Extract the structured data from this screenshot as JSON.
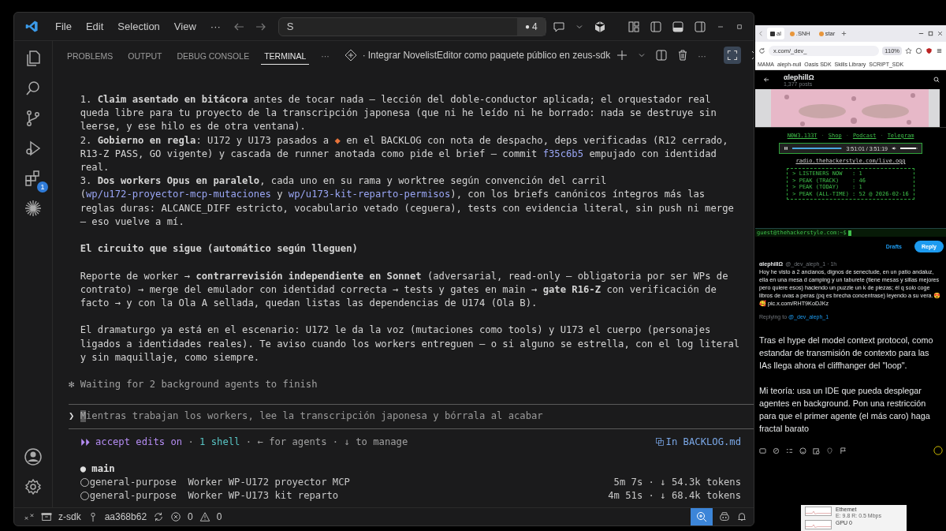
{
  "titlebar": {
    "menu": [
      "File",
      "Edit",
      "Selection",
      "View"
    ],
    "more": "···",
    "search": {
      "value": "S"
    },
    "session_dot": "●",
    "session_count": "4"
  },
  "activity_bar": {
    "extensions_badge": "1"
  },
  "panel": {
    "tabs": [
      {
        "label": "PROBLEMS",
        "selected": false
      },
      {
        "label": "OUTPUT",
        "selected": false
      },
      {
        "label": "DEBUG CONSOLE",
        "selected": false
      },
      {
        "label": "TERMINAL",
        "selected": true
      }
    ],
    "more": "···",
    "title_separator": "·",
    "terminal_title": "Integrar NovelistEditor como paquete público en zeus-sdk",
    "terminal_more": "···",
    "maximized": true
  },
  "terminal": {
    "blocks": [
      {
        "kind": "item",
        "segments": [
          {
            "kind": "plain",
            "text": "1. "
          },
          {
            "kind": "bold",
            "text": "Claim asentado en bitácora"
          },
          {
            "kind": "plain",
            "text": " antes de tocar nada — lección del doble-conductor aplicada; el orquestador real queda libre para tu proyecto de la transcripción japonesa (que ni he leído ni he borrado: nada se destruye sin leerse, y ese hilo es de otra ventana)."
          }
        ]
      },
      {
        "kind": "item",
        "segments": [
          {
            "kind": "plain",
            "text": "2. "
          },
          {
            "kind": "bold",
            "text": "Gobierno en regla"
          },
          {
            "kind": "plain",
            "text": ": U172 y U173 pasados a "
          },
          {
            "kind": "diamond",
            "text": "◆"
          },
          {
            "kind": "plain",
            "text": " en el BACKLOG con nota de despacho, deps verificadas (R12 cerrado, R13-Z PASS, GO vigente) y cascada de runner anotada como pide el brief — commit "
          },
          {
            "kind": "link",
            "text": "f35c6b5"
          },
          {
            "kind": "plain",
            "text": " empujado con identidad real."
          }
        ]
      },
      {
        "kind": "item",
        "segments": [
          {
            "kind": "plain",
            "text": "3. "
          },
          {
            "kind": "bold",
            "text": "Dos workers Opus en paralelo"
          },
          {
            "kind": "plain",
            "text": ", cada uno en su rama y worktree según convención del carril ("
          },
          {
            "kind": "link",
            "text": "wp/u172-proyector-mcp-mutaciones"
          },
          {
            "kind": "plain",
            "text": " y "
          },
          {
            "kind": "link",
            "text": "wp/u173-kit-reparto-permisos"
          },
          {
            "kind": "plain",
            "text": "), con los briefs canónicos íntegros más las reglas duras: ALCANCE_DIFF estricto, vocabulario vetado (ceguera), tests con evidencia literal, sin push ni merge — eso vuelve a mí."
          }
        ]
      },
      {
        "kind": "heading",
        "segments": [
          {
            "kind": "plain",
            "text": "El circuito que sigue (automático según lleguen)"
          }
        ]
      },
      {
        "kind": "paragraph",
        "segments": [
          {
            "kind": "plain",
            "text": "Reporte de worker → "
          },
          {
            "kind": "bold",
            "text": "contrarrevisión independiente en Sonnet"
          },
          {
            "kind": "plain",
            "text": " (adversarial, read-only — obligatoria por ser WPs de contrato) → merge del emulador con identidad correcta → tests y gates en main → "
          },
          {
            "kind": "bold",
            "text": "gate R16-Z"
          },
          {
            "kind": "plain",
            "text": " con verificación de facto → y con la Ola A sellada, quedan listas las dependencias de U174 (Ola B)."
          }
        ]
      },
      {
        "kind": "paragraph",
        "segments": [
          {
            "kind": "plain",
            "text": "El dramaturgo ya está en el escenario: U172 le da la voz (mutaciones como tools) y U173 el cuerpo (personajes ligados a identidades reales). Te aviso cuando los workers entreguen — o si alguno se estrella, con el log literal y sin maquillaje, como siempre."
          }
        ]
      }
    ],
    "status": {
      "spinner": "✻",
      "text": "Waiting for 2 background agents to finish"
    },
    "prompt": {
      "symbol": "❯",
      "value": "Mientras trabajan los workers, lee la transcripción japonesa y bórrala al acabar"
    },
    "mode_line": [
      {
        "kind": "mode",
        "text": "⏵⏵ accept edits on"
      },
      {
        "kind": "dim",
        "text": " · "
      },
      {
        "kind": "shell",
        "text": "1 shell"
      },
      {
        "kind": "dim",
        "text": " · ← for agents · ↓ to manage"
      }
    ],
    "open_file": "In BACKLOG.md",
    "agents": {
      "bullet": "●",
      "main": "main",
      "rows": [
        {
          "type": "general-purpose",
          "task": "Worker WP-U172 proyector MCP",
          "stats": "5m 7s · ↓ 54.3k tokens"
        },
        {
          "type": "general-purpose",
          "task": "Worker WP-U173 kit reparto",
          "stats": "4m 51s · ↓ 68.4k tokens"
        }
      ]
    }
  },
  "status_bar": {
    "repo": "z-sdk",
    "commit": "aa368b62",
    "errors": "0",
    "warnings": "0"
  },
  "browser": {
    "tabs": [
      {
        "label": "al",
        "selected": true
      },
      {
        "label": ".SNH",
        "selected": false
      },
      {
        "label": "star",
        "selected": false
      }
    ],
    "address": "x.com/_dev_",
    "zoom": "110%",
    "bookmarks": [
      "MAMA",
      "aleph-null",
      "Oasis SDK",
      "Skills Library",
      "SCRIPT_SDK"
    ],
    "profile": {
      "name": "αlephillΩ",
      "posts": "1,377 posts"
    },
    "embed": {
      "links": [
        "N0W3.133T",
        "Shop",
        "Podcast",
        "Telegram"
      ],
      "separator": "·",
      "player": {
        "level": 0.97,
        "time": "3:51:01 / 3:51:19",
        "volume": {
          "level": 0.9
        }
      },
      "stream_url": "radio.thehackerstyle.com/live.ogg",
      "stats": [
        "> LISTENERS NOW   : 1",
        "> PEAK (TRACK)    : 46",
        "> PEAK (TODAY)    : 1",
        "> PEAK (ALL-TIME) : 52 @ 2026-02-16"
      ],
      "shell_prompt": "guest@thehackerstyle.com:~$"
    },
    "drafts": "Drafts",
    "reply": "Reply",
    "tweet": {
      "name": "αlephillΩ",
      "handle": "@_dev_aleph_1 · 1h",
      "text": "Hoy he visto a 2 ancianos, dignos de senectude, en un patio andaluz, ella en una mesa d camping y un taburete (tiene mesas y sillas mejores pero quiere esos) haciendo un puzzle un k de piezas; él q solo coge libros de uvas a peras (pq es brecha concentrase) leyendo a su vera.😍🥰",
      "link": "pic.x.com/RHT9KoDJKz"
    },
    "replying_to": "Replying to",
    "reply_handle": "@_dev_aleph_1",
    "compose": [
      "Tras el hype del model context protocol, como estandar de transmisión de contexto para las IAs llega ahora el cliffhanger del \"loop\".",
      "Mi teoría: usa un IDE que pueda desplegar agentes en background. Pon una restricción para que el primer agente (el más caro) haga fractal barato"
    ]
  },
  "task_popup": {
    "items": [
      {
        "name": "Ethernet",
        "detail": "E: 9.8 R: 0.5 Mbps"
      },
      {
        "name": "GPU 0"
      }
    ]
  }
}
